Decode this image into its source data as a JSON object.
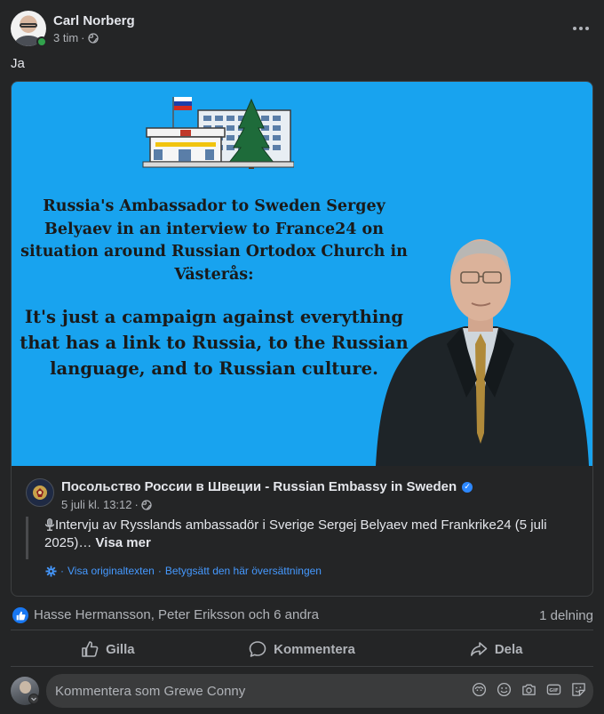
{
  "author": {
    "name": "Carl Norberg",
    "time": "3 tim",
    "separator": "·"
  },
  "post": {
    "text": "Ja"
  },
  "image": {
    "headline": "Russia's Ambassador to Sweden Sergey Belyaev in an interview to France24 on situation around Russian Ortodox Church in Västerås:",
    "quote": "It's just a campaign against everything that has a link to Russia, to the Russian language, and to Russian culture."
  },
  "shared": {
    "page_name": "Посольство России в Швеции - Russian Embassy in Sweden",
    "date": "5 juli kl. 13:12",
    "separator": "·",
    "text": "Intervju av Rysslands ambassadör i Sverige Sergej Belyaev med Frankrike24 (5 juli 2025)…",
    "see_more": "Visa mer",
    "translation": {
      "sep1": "·",
      "show_original": "Visa originaltexten",
      "sep2": "·",
      "rate": "Betygsätt den här översättningen"
    }
  },
  "reactions": {
    "names": "Hasse Hermansson, Peter Eriksson och 6 andra",
    "shares": "1 delning"
  },
  "actions": {
    "like": "Gilla",
    "comment": "Kommentera",
    "share": "Dela"
  },
  "composer": {
    "placeholder": "Kommentera som Grewe Conny"
  },
  "icons": [
    "globe-icon",
    "more-icon",
    "verified-icon",
    "mic-icon",
    "gear-icon",
    "like-icon",
    "comment-icon",
    "share-icon",
    "avatar-icon",
    "emoji-icon",
    "camera-icon",
    "gif-icon",
    "sticker-icon"
  ],
  "colors": {
    "accent": "#2d88ff",
    "card_bg": "#18a3ef",
    "like": "#1877f2",
    "online": "#31a24c"
  }
}
